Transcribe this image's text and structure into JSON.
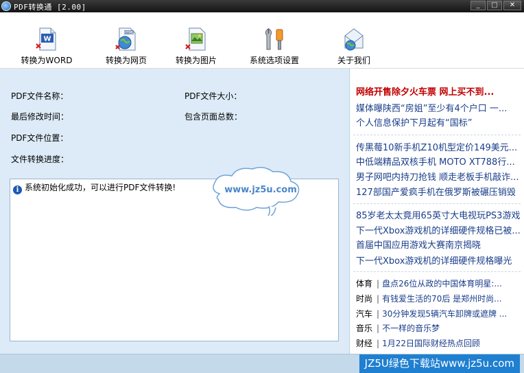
{
  "window": {
    "title": "PDF转换通 [2.00]"
  },
  "toolbar": {
    "items": [
      {
        "label": "转换为WORD"
      },
      {
        "label": "转换为网页"
      },
      {
        "label": "转换为图片"
      },
      {
        "label": "系统选项设置"
      },
      {
        "label": "关于我们"
      }
    ]
  },
  "file_info": {
    "name_label": "PDF文件名称：",
    "size_label": "PDF文件大小：",
    "modified_label": "最后修改时间：",
    "pages_label": "包含页面总数：",
    "location_label": "PDF文件位置：",
    "progress_label": "文件转换进度："
  },
  "log": {
    "message": "系统初始化成功，可以进行PDF文件转换!"
  },
  "watermark_cloud": {
    "text": "www.jz5u.com"
  },
  "news": {
    "headline": "网络开售除夕火车票  网上买不到...",
    "group1": [
      "媒体曝陕西“房姐”至少有4个户口 一...",
      "个人信息保护下月起有“国标”"
    ],
    "group2": [
      "传黑莓10新手机Z10机型定价149美元...",
      "中低端精品双核手机 MOTO XT788行...",
      "男子网吧内持刀抢钱 顺走老板手机敲诈...",
      "127部国产爱疯手机在俄罗斯被碾压销毁"
    ],
    "group3": [
      "85岁老太太竟用65英寸大电视玩PS3游戏",
      "下一代Xbox游戏机的详细硬件规格已被...",
      "首届中国应用游戏大赛南京揭晓",
      "下一代Xbox游戏机的详细硬件规格曝光"
    ],
    "categories": [
      {
        "cat": "体育",
        "text": "盘点26位从政的中国体育明星:..."
      },
      {
        "cat": "时尚",
        "text": "有钱爱生活的70后 是郑州时尚..."
      },
      {
        "cat": "汽车",
        "text": "30分钟发现5辆汽车卸牌或遮牌 ..."
      },
      {
        "cat": "音乐",
        "text": "不一样的音乐梦"
      },
      {
        "cat": "财经",
        "text": "1月22日国际财经热点回顾"
      }
    ]
  },
  "bottom_watermark": {
    "text": "JZ5U绿色下载站www.jz5u.com"
  }
}
